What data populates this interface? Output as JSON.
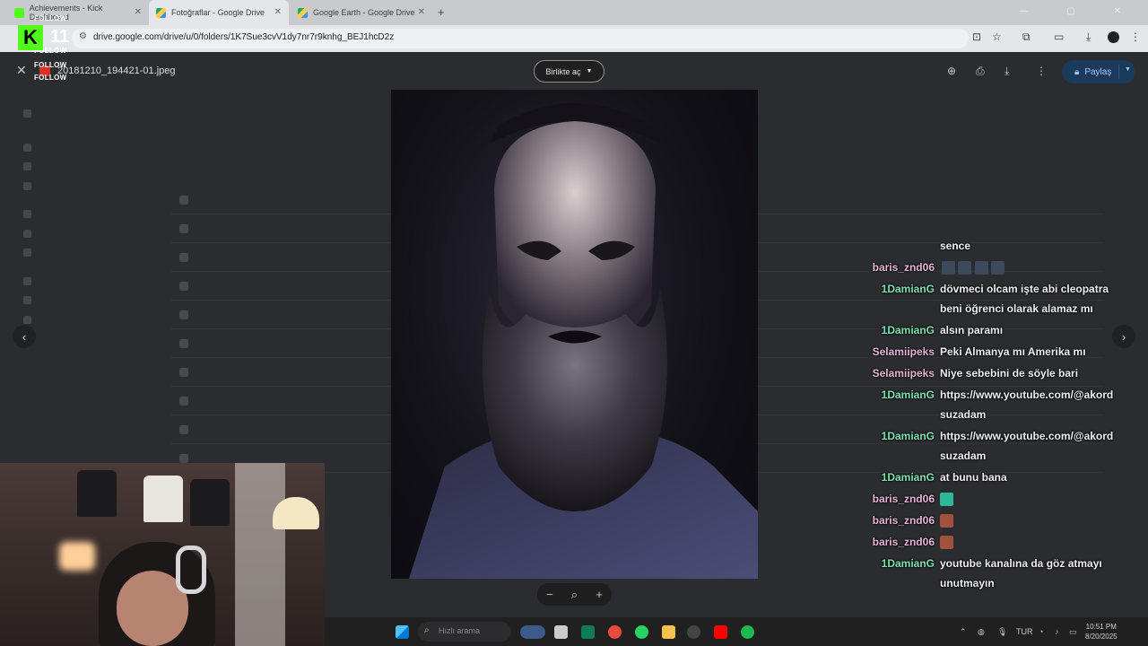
{
  "browser": {
    "tabs": [
      {
        "label": "Achievements - Kick Dashboard",
        "active": false
      },
      {
        "label": "Fotoğraflar - Google Drive",
        "active": true
      },
      {
        "label": "Google Earth - Google Drive",
        "active": false
      }
    ],
    "url": "drive.google.com/drive/u/0/folders/1K7Sue3cvV1dy7nr7r9knhg_BEJ1hcD2z"
  },
  "viewer": {
    "filename": "20181210_194421-01.jpeg",
    "open_with_label": "Birlikte aç",
    "share_label": "Paylaş"
  },
  "kick_overlay": {
    "follow_labels": [
      "FOLLOW",
      "FOLLOW",
      "FOLLOW",
      "FOLLOW"
    ],
    "logo_letter": "K",
    "count": "11"
  },
  "chat": [
    {
      "user": "",
      "message": "sence",
      "user_color": "#e8b4d8"
    },
    {
      "user": "baris_znd06",
      "message": "",
      "user_color": "#e8b4d8",
      "emotes": 4
    },
    {
      "user": "1DamianG",
      "message": "dövmeci olcam işte abi cleopatra",
      "user_color": "#7ee0b0"
    },
    {
      "user": "",
      "message": "beni öğrenci olarak alamaz mı",
      "user_color": "#7ee0b0"
    },
    {
      "user": "1DamianG",
      "message": "alsın paramı",
      "user_color": "#7ee0b0"
    },
    {
      "user": "Selamiipeks",
      "message": "Peki Almanya mı Amerika mı",
      "user_color": "#e8b4d8"
    },
    {
      "user": "Selamiipeks",
      "message": "Niye sebebini de söyle bari",
      "user_color": "#e8b4d8"
    },
    {
      "user": "1DamianG",
      "message": "https://www.youtube.com/@akord",
      "user_color": "#7ee0b0"
    },
    {
      "user": "",
      "message": "suzadam",
      "user_color": "#7ee0b0"
    },
    {
      "user": "1DamianG",
      "message": "https://www.youtube.com/@akord",
      "user_color": "#7ee0b0"
    },
    {
      "user": "",
      "message": "suzadam",
      "user_color": "#7ee0b0"
    },
    {
      "user": "1DamianG",
      "message": "at bunu bana",
      "user_color": "#7ee0b0"
    },
    {
      "user": "baris_znd06",
      "message": "",
      "user_color": "#e8b4d8",
      "emotes": 1
    },
    {
      "user": "baris_znd06",
      "message": "",
      "user_color": "#e8b4d8",
      "emotes": 1
    },
    {
      "user": "baris_znd06",
      "message": "",
      "user_color": "#e8b4d8",
      "emotes": 1
    },
    {
      "user": "1DamianG",
      "message": "youtube kanalına da göz atmayı",
      "user_color": "#7ee0b0"
    },
    {
      "user": "",
      "message": "unutmayın",
      "user_color": "#7ee0b0"
    }
  ],
  "taskbar": {
    "search_placeholder": "Hızlı arama",
    "language": "TUR",
    "time": "10:51 PM",
    "date": "8/20/2025"
  },
  "colors": {
    "kick_green": "#53fc18",
    "share_bg": "#1a3a5c",
    "share_text": "#a8c7fa"
  }
}
